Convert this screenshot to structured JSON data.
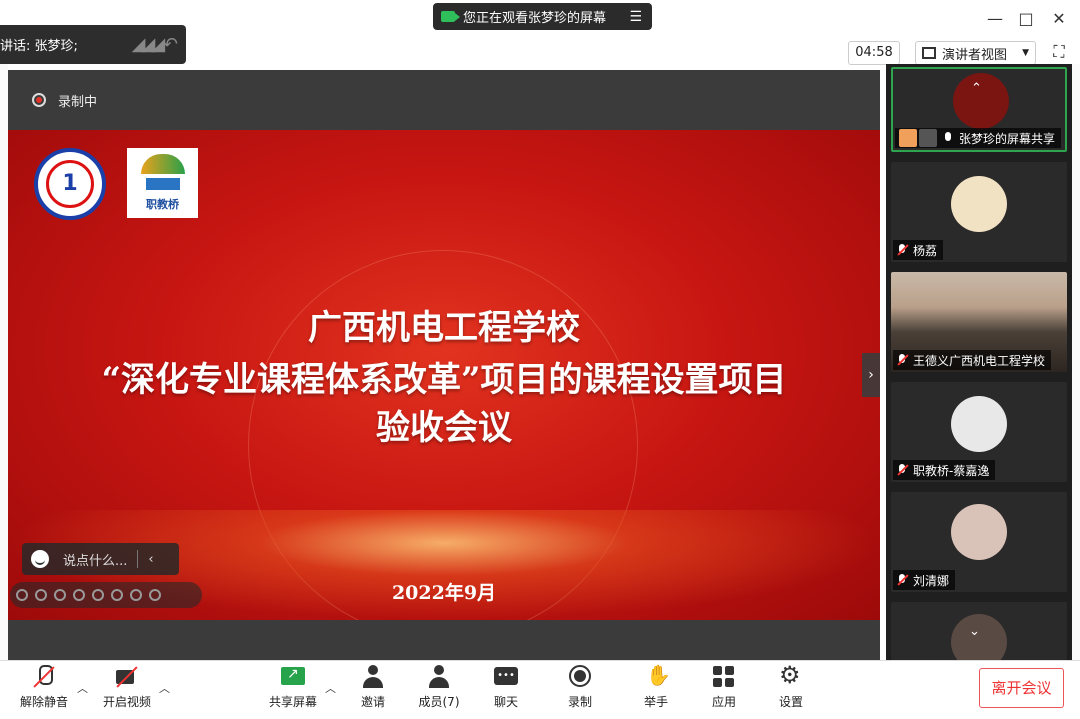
{
  "window": {
    "viewing_text": "您正在观看张梦珍的屏幕",
    "speaking_text": "讲话: 张梦珍;",
    "timer": "04:58",
    "view_mode": "演讲者视图",
    "minimize": "—",
    "maximize": "□",
    "close": "✕"
  },
  "share": {
    "recording_label": "录制中",
    "chat_placeholder": "说点什么...",
    "slide": {
      "title_line1": "广西机电工程学校",
      "title_line2": "“深化专业课程体系改革”项目的课程设置项目",
      "title_line3": "验收会议",
      "date": "2022年9月",
      "logo2_text": "职教桥"
    }
  },
  "participants": [
    {
      "name": "张梦珍的屏幕共享",
      "mic": "on",
      "active": true
    },
    {
      "name": "杨荔",
      "mic": "off"
    },
    {
      "name": "王德义广西机电工程学校",
      "mic": "off"
    },
    {
      "name": "职教桥-蔡嘉逸",
      "mic": "off"
    },
    {
      "name": "刘清娜",
      "mic": "off"
    }
  ],
  "toolbar": {
    "unmute": "解除静音",
    "start_video": "开启视频",
    "share_screen": "共享屏幕",
    "invite": "邀请",
    "members": "成员(7)",
    "chat": "聊天",
    "record": "录制",
    "raise_hand": "举手",
    "apps": "应用",
    "settings": "设置",
    "leave": "离开会议"
  },
  "colors": {
    "slide_red": "#c81612",
    "accent_green": "#2ea44f",
    "leave_red": "#e33333"
  }
}
